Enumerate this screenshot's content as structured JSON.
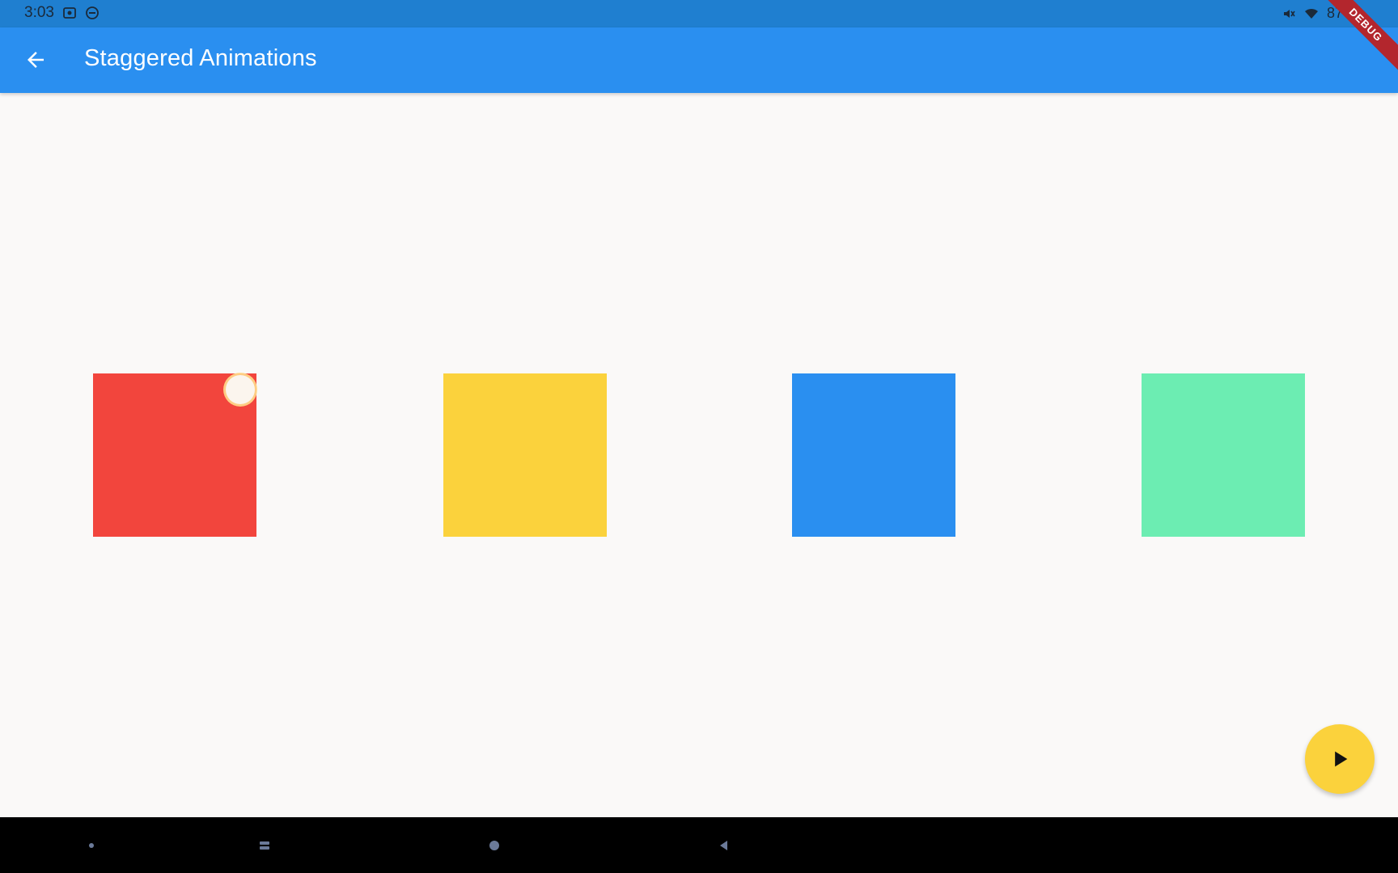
{
  "status_bar": {
    "time": "3:03",
    "battery_text": "87",
    "icons": [
      "screenshot-icon",
      "do-not-disturb-icon",
      "mute-icon",
      "wifi-icon",
      "battery-icon"
    ]
  },
  "debug_banner": "DEBUG",
  "app_bar": {
    "back_icon": "arrow-back-icon",
    "title": "Staggered Animations",
    "color": "#2a8ff0"
  },
  "squares": [
    {
      "name": "red",
      "color": "#f2453d"
    },
    {
      "name": "yellow",
      "color": "#fbd23c"
    },
    {
      "name": "blue",
      "color": "#2a8ff0"
    },
    {
      "name": "green",
      "color": "#6cedb2"
    }
  ],
  "fab": {
    "icon": "play-icon",
    "color": "#fbd23c"
  },
  "nav_bar": {
    "items": [
      "recents-dot-icon",
      "recents-icon",
      "home-icon",
      "back-triangle-icon"
    ]
  }
}
